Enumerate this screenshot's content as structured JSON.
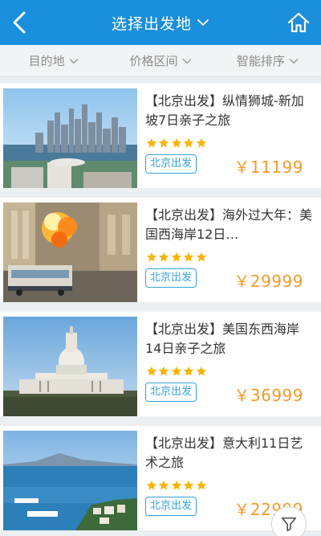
{
  "header": {
    "title": "选择出发地",
    "back_icon": "chevron-left-icon",
    "home_icon": "home-icon"
  },
  "filters": [
    {
      "label": "目的地"
    },
    {
      "label": "价格区间"
    },
    {
      "label": "智能排序"
    }
  ],
  "colors": {
    "header_bg": "#1a8fdc",
    "price": "#f39a2b",
    "star": "#f5b400",
    "tag_border": "#38a1da"
  },
  "items": [
    {
      "title": "【北京出发】纵情狮城-新加坡7日亲子之旅",
      "tag": "北京出发",
      "price": "￥11199",
      "rating": 5
    },
    {
      "title": "【北京出发】海外过大年：美国西海岸12日…",
      "tag": "北京出发",
      "price": "￥29999",
      "rating": 5
    },
    {
      "title": "【北京出发】美国东西海岸14日亲子之旅",
      "tag": "北京出发",
      "price": "￥36999",
      "rating": 5
    },
    {
      "title": "【北京出发】意大利11日艺术之旅",
      "tag": "北京出发",
      "price": "￥22999",
      "rating": 5
    }
  ],
  "filter_button_icon": "filter-icon"
}
